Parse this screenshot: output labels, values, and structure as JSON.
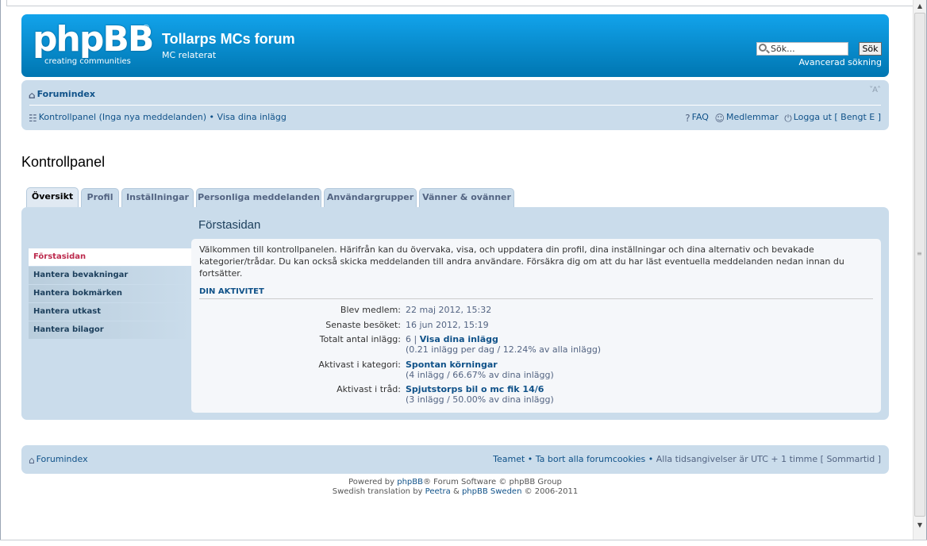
{
  "header": {
    "logo_text": "phpBB",
    "logo_reg": "®",
    "logo_tagline": "creating  communities",
    "site_name": "Tollarps MCs forum",
    "site_desc": "MC relaterat",
    "search_placeholder": "Sök...",
    "search_button": "Sök",
    "advanced_search": "Avancerad sökning"
  },
  "navbar": {
    "forum_index": "Forumindex",
    "font_size": "˅A˄",
    "ucp_link": "Kontrollpanel (Inga nya meddelanden)",
    "bullet": "•",
    "view_posts": "Visa dina inlägg",
    "faq": "FAQ",
    "members": "Medlemmar",
    "logout": "Logga ut [ Bengt E ]"
  },
  "page_title": "Kontrollpanel",
  "tabs": [
    "Översikt",
    "Profil",
    "Inställningar",
    "Personliga meddelanden",
    "Användargrupper",
    "Vänner & ovänner"
  ],
  "panel": {
    "title": "Förstasidan",
    "menu": [
      "Förstasidan",
      "Hantera bevakningar",
      "Hantera bokmärken",
      "Hantera utkast",
      "Hantera bilagor"
    ],
    "intro": "Välkommen till kontrollpanelen. Härifrån kan du övervaka, visa, och uppdatera din profil, dina inställningar och dina alternativ och bevakade kategorier/trådar. Du kan också skicka meddelanden till andra användare. Försäkra dig om att du har läst eventuella meddelanden nedan innan du fortsätter.",
    "section": "DIN AKTIVITET",
    "stats": {
      "joined_label": "Blev medlem:",
      "joined_value": "22 maj 2012, 15:32",
      "visit_label": "Senaste besöket:",
      "visit_value": "16 jun 2012, 15:19",
      "posts_label": "Totalt antal inlägg:",
      "posts_count": "6 | ",
      "posts_link": "Visa dina inlägg",
      "posts_sub": "(0.21 inlägg per dag / 12.24% av alla inlägg)",
      "forum_label": "Aktivast i kategori:",
      "forum_value": "Spontan körningar",
      "forum_sub": "(4 inlägg / 66.67% av dina inlägg)",
      "topic_label": "Aktivast i tråd:",
      "topic_value": "Spjutstorps bil o mc fik 14/6",
      "topic_sub": "(3 inlägg / 50.00% av dina inlägg)"
    }
  },
  "footer": {
    "forum_index": "Forumindex",
    "team": "Teamet",
    "bullet": " • ",
    "delete_cookies": "Ta bort alla forumcookies",
    "timezone": "Alla tidsangivelser är UTC + 1 timme [ Sommartid ]",
    "powered_pre": "Powered by ",
    "powered_link": "phpBB",
    "powered_post": "® Forum Software © phpBB Group",
    "trans_pre": "Swedish translation by ",
    "trans_link1": "Peetra",
    "trans_mid": " & ",
    "trans_link2": "phpBB Sweden",
    "trans_post": " © 2006-2011"
  }
}
